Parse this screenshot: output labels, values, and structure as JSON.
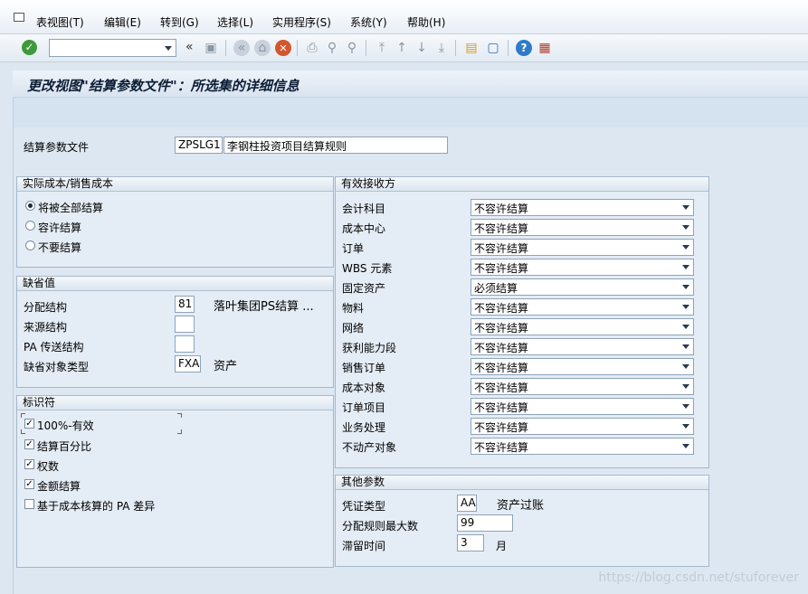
{
  "menu": {
    "items": [
      "表视图(T)",
      "编辑(E)",
      "转到(G)",
      "选择(L)",
      "实用程序(S)",
      "系统(Y)",
      "帮助(H)"
    ]
  },
  "toolbar": {
    "command_value": "",
    "back_symbol": "«"
  },
  "page": {
    "title": "更改视图\"结算参数文件\"：所选集的详细信息"
  },
  "profile": {
    "label": "结算参数文件",
    "code": "ZPSLG1",
    "description": "李钢柱投资项目结算规则"
  },
  "actual_cost": {
    "heading": "实际成本/销售成本",
    "options": [
      {
        "label": "将被全部结算",
        "selected": true
      },
      {
        "label": "容许结算",
        "selected": false
      },
      {
        "label": "不要结算",
        "selected": false
      }
    ]
  },
  "defaults": {
    "heading": "缺省值",
    "rows": [
      {
        "label": "分配结构",
        "value": "81",
        "text": "落叶集团PS结算 ..."
      },
      {
        "label": "来源结构",
        "value": "",
        "text": ""
      },
      {
        "label": "PA 传送结构",
        "value": "",
        "text": ""
      },
      {
        "label": "缺省对象类型",
        "value": "FXA",
        "text": "资产"
      }
    ]
  },
  "indicators": {
    "heading": "标识符",
    "items": [
      {
        "label": "100%-有效",
        "checked": true
      },
      {
        "label": "结算百分比",
        "checked": true
      },
      {
        "label": "权数",
        "checked": true
      },
      {
        "label": "金额结算",
        "checked": true
      },
      {
        "label": "基于成本核算的 PA 差异",
        "checked": false
      }
    ]
  },
  "receivers": {
    "heading": "有效接收方",
    "rows": [
      {
        "label": "会计科目",
        "value": "不容许结算"
      },
      {
        "label": "成本中心",
        "value": "不容许结算"
      },
      {
        "label": "订单",
        "value": "不容许结算"
      },
      {
        "label": "WBS 元素",
        "value": "不容许结算"
      },
      {
        "label": "固定资产",
        "value": "必须结算"
      },
      {
        "label": "物料",
        "value": "不容许结算"
      },
      {
        "label": "网络",
        "value": "不容许结算"
      },
      {
        "label": "获利能力段",
        "value": "不容许结算"
      },
      {
        "label": "销售订单",
        "value": "不容许结算"
      },
      {
        "label": "成本对象",
        "value": "不容许结算"
      },
      {
        "label": "订单项目",
        "value": "不容许结算"
      },
      {
        "label": "业务处理",
        "value": "不容许结算"
      },
      {
        "label": "不动产对象",
        "value": "不容许结算"
      }
    ]
  },
  "other": {
    "heading": "其他参数",
    "doc_type_label": "凭证类型",
    "doc_type_value": "AA",
    "doc_type_text": "资产过账",
    "max_rules_label": "分配规则最大数",
    "max_rules_value": "99",
    "retention_label": "滞留时间",
    "retention_value": "3",
    "retention_unit": "月"
  },
  "watermark": "https://blog.csdn.net/stuforever"
}
